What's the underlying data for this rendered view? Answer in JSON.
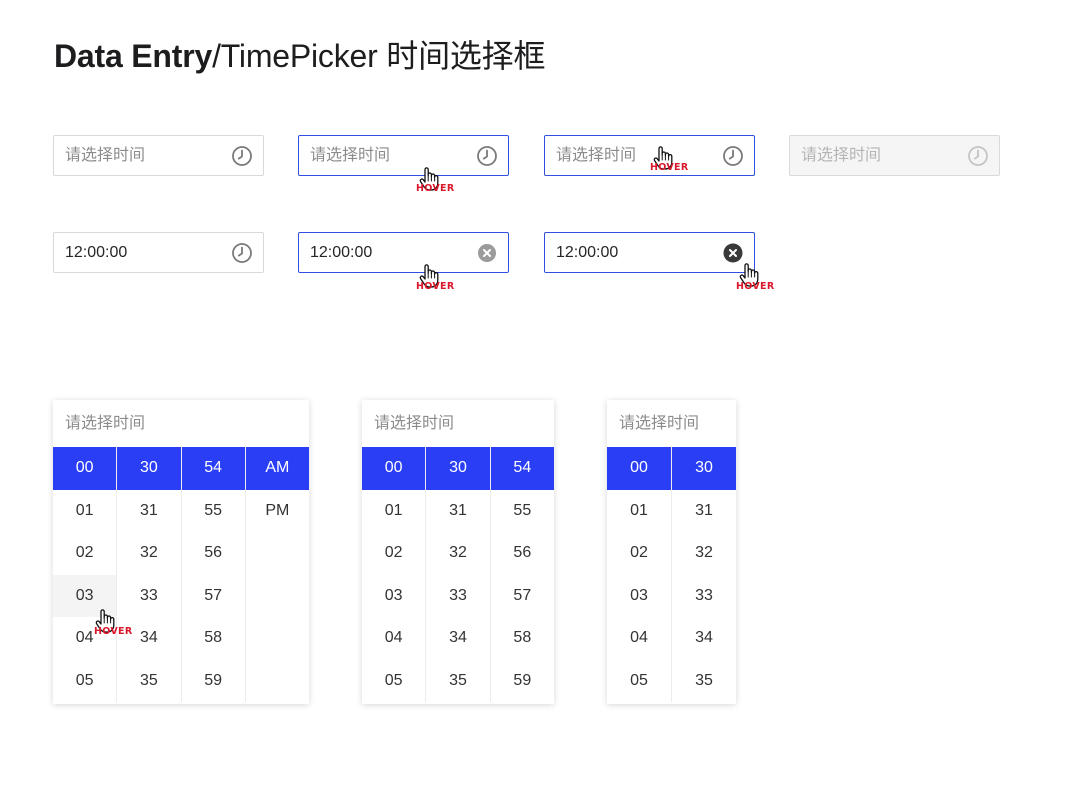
{
  "page": {
    "title_bold": "Data Entry",
    "title_rest": "/TimePicker 时间选择框"
  },
  "inputs_row1": [
    {
      "placeholder": "请选择时间",
      "state": "default"
    },
    {
      "placeholder": "请选择时间",
      "state": "hover"
    },
    {
      "placeholder": "请选择时间",
      "state": "active"
    },
    {
      "placeholder": "请选择时间",
      "state": "disabled"
    }
  ],
  "inputs_row2": [
    {
      "value": "12:00:00",
      "state": "default"
    },
    {
      "value": "12:00:00",
      "state": "hover"
    },
    {
      "value": "12:00:00",
      "state": "clear-hover"
    }
  ],
  "hover_label": "HOVER",
  "panels": [
    {
      "header": "请选择时间",
      "columns": [
        [
          "00",
          "01",
          "02",
          "03",
          "04",
          "05"
        ],
        [
          "30",
          "31",
          "32",
          "33",
          "34",
          "35"
        ],
        [
          "54",
          "55",
          "56",
          "57",
          "58",
          "59"
        ],
        [
          "AM",
          "PM"
        ]
      ]
    },
    {
      "header": "请选择时间",
      "columns": [
        [
          "00",
          "01",
          "02",
          "03",
          "04",
          "05"
        ],
        [
          "30",
          "31",
          "32",
          "33",
          "34",
          "35"
        ],
        [
          "54",
          "55",
          "56",
          "57",
          "58",
          "59"
        ]
      ]
    },
    {
      "header": "请选择时间",
      "columns": [
        [
          "00",
          "01",
          "02",
          "03",
          "04",
          "05"
        ],
        [
          "30",
          "31",
          "32",
          "33",
          "34",
          "35"
        ]
      ]
    }
  ],
  "colors": {
    "accent": "#2a3ff5",
    "focus_border": "#2f4fe0",
    "hover_tag": "#d9192b",
    "disabled_bg": "#f5f5f5"
  },
  "icons": [
    "clock-icon",
    "clear-icon",
    "hand-cursor-icon"
  ]
}
